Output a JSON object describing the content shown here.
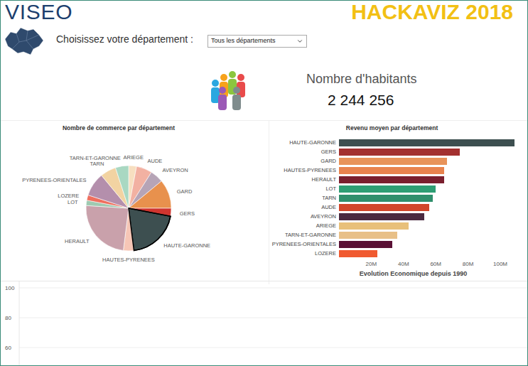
{
  "header": {
    "logo": "VISEO",
    "event": "HACKAVIZ 2018"
  },
  "filter": {
    "label": "Choisissez votre département :",
    "value": "Tous les départements"
  },
  "population": {
    "label": "Nombre d'habitants",
    "value": "2 244 256"
  },
  "pie_chart": {
    "title": "Nombre de commerce par département",
    "slices": [
      {
        "label": "ARIEGE",
        "value": 3,
        "color": "#f7dfc0",
        "selected": false
      },
      {
        "label": "AUDE",
        "value": 6,
        "color": "#f2b1a2",
        "selected": false
      },
      {
        "label": "AVEYRON",
        "value": 5,
        "color": "#b6a4b6",
        "selected": false
      },
      {
        "label": "GARD",
        "value": 11,
        "color": "#e8914d",
        "selected": false
      },
      {
        "label": "GERS",
        "value": 3,
        "color": "#d0352f",
        "selected": false
      },
      {
        "label": "HAUTE-GARONNE",
        "value": 20,
        "color": "#3d4f50",
        "selected": true
      },
      {
        "label": "HAUTES-PYRENEES",
        "value": 4,
        "color": "#f6c6b6",
        "selected": false
      },
      {
        "label": "HERAULT",
        "value": 24,
        "color": "#c9a1ab",
        "selected": false
      },
      {
        "label": "LOT",
        "value": 2,
        "color": "#9fcab2",
        "selected": false
      },
      {
        "label": "LOZERE",
        "value": 2,
        "color": "#ef6f5e",
        "selected": false
      },
      {
        "label": "PYRENEES-ORIENTALES",
        "value": 9,
        "color": "#b48fac",
        "selected": false
      },
      {
        "label": "TARN",
        "value": 6,
        "color": "#f2d3a2",
        "selected": false
      },
      {
        "label": "TARN-ET-GARONNE",
        "value": 5,
        "color": "#a9d8c2",
        "selected": false
      }
    ]
  },
  "bar_chart": {
    "title": "Revenu moyen par département",
    "bars": [
      {
        "label": "HAUTE-GARONNE",
        "value": 109,
        "color": "#3d4f50"
      },
      {
        "label": "GERS",
        "value": 75,
        "color": "#a3302f"
      },
      {
        "label": "GARD",
        "value": 67,
        "color": "#e8935a"
      },
      {
        "label": "HAUTES-PYRENEES",
        "value": 65,
        "color": "#e8834e"
      },
      {
        "label": "HERAULT",
        "value": 65,
        "color": "#7a1f2e"
      },
      {
        "label": "LOT",
        "value": 60,
        "color": "#2e9e74"
      },
      {
        "label": "TARN",
        "value": 58,
        "color": "#2f8f6c"
      },
      {
        "label": "AUDE",
        "value": 56,
        "color": "#d2462a"
      },
      {
        "label": "AVEYRON",
        "value": 53,
        "color": "#4a2a40"
      },
      {
        "label": "ARIEGE",
        "value": 43,
        "color": "#e8c07a"
      },
      {
        "label": "TARN-ET-GARONNE",
        "value": 36,
        "color": "#e8c088"
      },
      {
        "label": "PYRENEES-ORIENTALES",
        "value": 33,
        "color": "#5a1035"
      },
      {
        "label": "LOZERE",
        "value": 24,
        "color": "#f05a30"
      }
    ],
    "ticks": [
      "20M",
      "40M",
      "60M",
      "80M",
      "100M"
    ]
  },
  "line_chart": {
    "title": "Evolution Economique depuis 1990",
    "y_ticks": [
      "100",
      "80",
      "60"
    ]
  }
}
